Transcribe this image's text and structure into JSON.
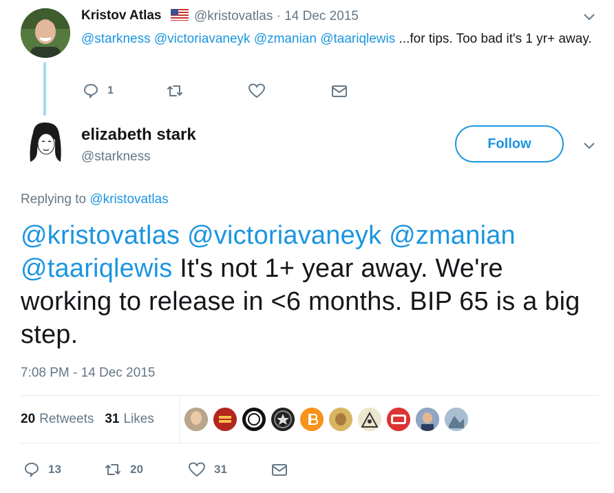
{
  "parent_tweet": {
    "author_name": "Kristov Atlas",
    "author_handle_date": "@kristovatlas · 14 Dec 2015",
    "text_mentions": "@starkness @victoriavaneyk @zmanian @taariqlewis",
    "text_body": " ...for tips. Too bad it's 1 yr+ away.",
    "reply_count": "1",
    "flag_icon": "us-flag-icon"
  },
  "main_tweet": {
    "author_name": "elizabeth stark",
    "author_handle": "@starkness",
    "follow_label": "Follow",
    "replying_prefix": "Replying to ",
    "replying_handle": "@kristovatlas",
    "text_mentions": "@kristovatlas @victoriavaneyk @zmanian @taariqlewis",
    "text_body": " It's not 1+ year away. We're working to release in <6 months. BIP 65 is a big step.",
    "timestamp": "7:08 PM - 14 Dec 2015",
    "retweets_count": "20",
    "retweets_label": "Retweets",
    "likes_count": "31",
    "likes_label": "Likes",
    "liker_avatars": [
      "avatar-1",
      "steak-frites",
      "zen",
      "star-coin",
      "bitcoin",
      "avatar-6",
      "avatar-7",
      "avatar-8",
      "avatar-9",
      "avatar-10"
    ],
    "action_reply_count": "13",
    "action_retweet_count": "20",
    "action_like_count": "31"
  },
  "colors": {
    "link": "#1b95e0",
    "muted": "#657786",
    "thread_line": "#a4d9f5",
    "text": "#14171a"
  }
}
